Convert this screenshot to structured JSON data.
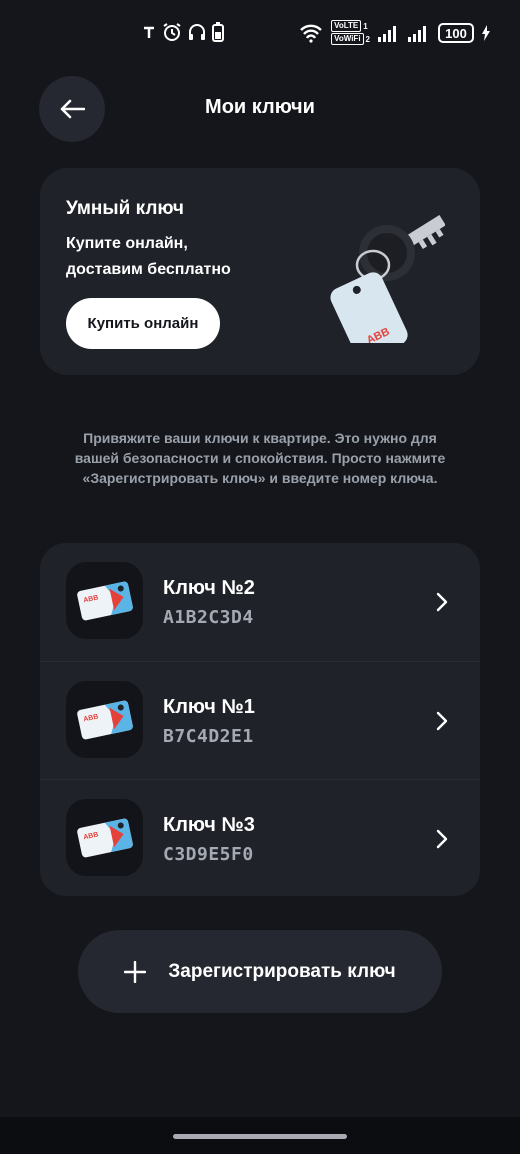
{
  "status_bar": {
    "volte1": "VoLTE",
    "volte2": "VoWiFi",
    "sim1": "1",
    "sim2": "2",
    "battery": "100"
  },
  "header": {
    "title": "Мои ключи"
  },
  "promo": {
    "title": "Умный ключ",
    "text": "Купите онлайн, доставим бесплатно",
    "button": "Купить онлайн"
  },
  "info_text": "Привяжите ваши ключи к квартире. Это нужно для вашей безопасности и спокойствия. Просто нажмите «Зарегистрировать ключ» и введите номер ключа.",
  "keys": [
    {
      "name": "Ключ №2",
      "code": "A1B2C3D4"
    },
    {
      "name": "Ключ №1",
      "code": "B7C4D2E1"
    },
    {
      "name": "Ключ №3",
      "code": "C3D9E5F0"
    }
  ],
  "register_button": "Зарегистрировать ключ",
  "colors": {
    "background": "#14161b",
    "card": "#1f2229",
    "brand_red": "#e4413b",
    "brand_blue": "#5ab4e6"
  }
}
